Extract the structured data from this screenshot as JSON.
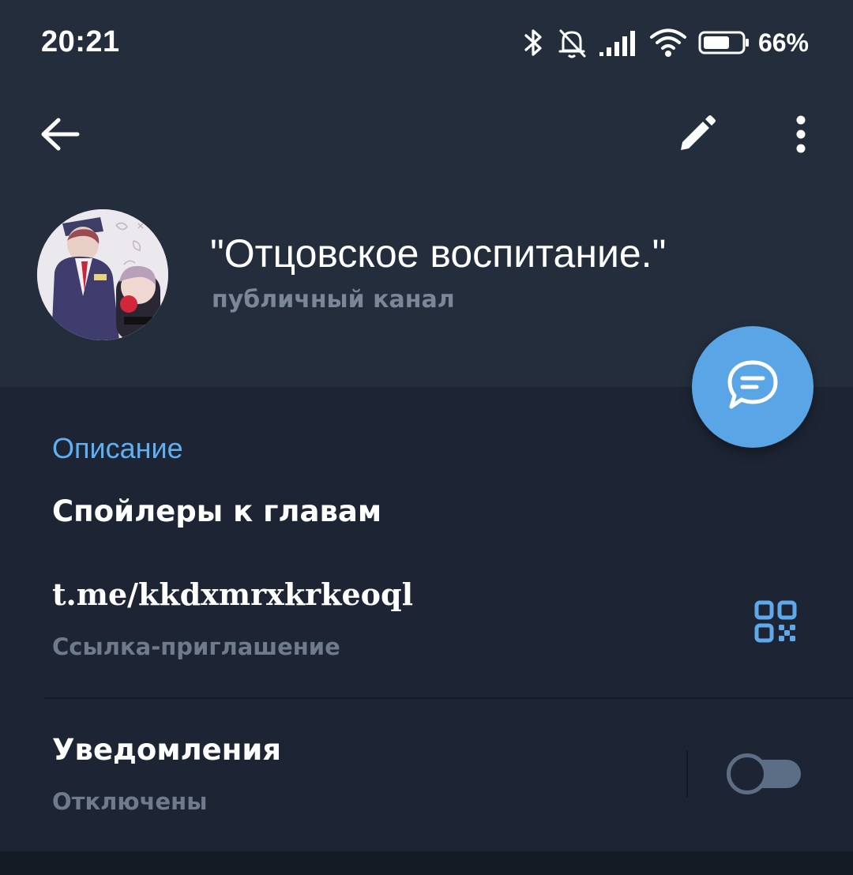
{
  "status_bar": {
    "time": "20:21",
    "battery_percent": "66%",
    "icons": [
      "bluetooth-icon",
      "bell-off-icon",
      "signal-icon",
      "wifi-icon",
      "battery-icon"
    ]
  },
  "toolbar": {
    "back_icon": "arrow-left-icon",
    "edit_icon": "pencil-icon",
    "more_icon": "more-vertical-icon"
  },
  "profile": {
    "title": "\"Отцовское воспитание.\"",
    "subtitle": "публичный канал",
    "avatar": "channel-avatar"
  },
  "fab": {
    "icon": "chat-bubble-icon",
    "color": "#5aa5e6"
  },
  "info": {
    "heading": "Описание",
    "description": "Спойлеры к главам",
    "link": "t.me/kkdxmrxkrkeoql",
    "link_label": "Ссылка-приглашение",
    "qr_icon": "qr-code-icon"
  },
  "notifications": {
    "title": "Уведомления",
    "status": "Отключены",
    "enabled": false
  },
  "colors": {
    "accent": "#5fb0f2",
    "header_bg": "#232d3c",
    "section_bg": "#1d2534"
  }
}
